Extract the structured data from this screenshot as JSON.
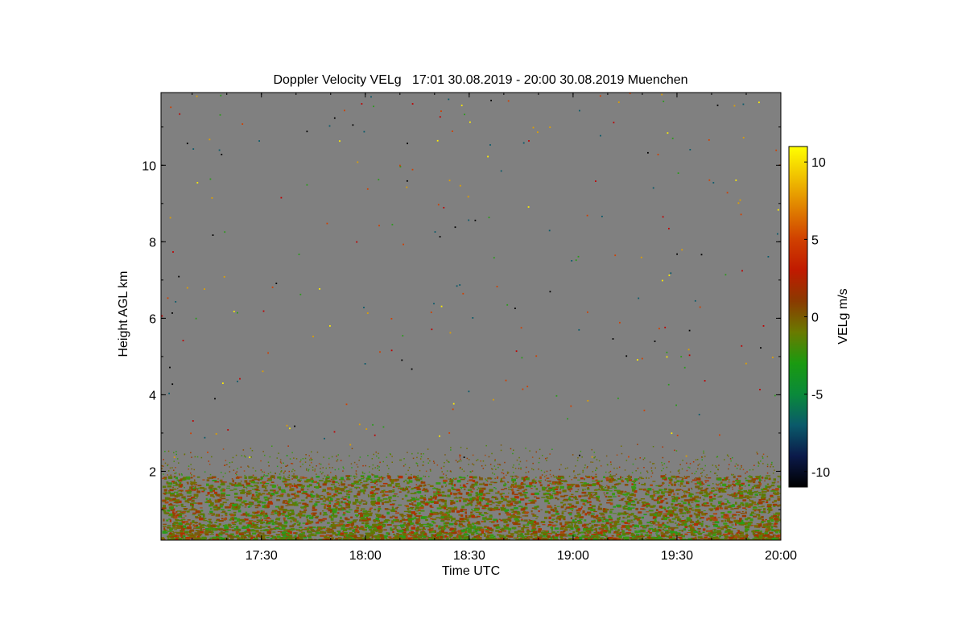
{
  "chart_data": {
    "type": "heatmap",
    "title": "Doppler Velocity VELg   17:01 30.08.2019 - 20:00 30.08.2019 Muenchen",
    "xlabel": "Time UTC",
    "ylabel": "Height AGL km",
    "x_range": [
      "17:01",
      "20:00"
    ],
    "y_range_km": [
      0.2,
      11.9
    ],
    "x_ticks": [
      "17:30",
      "18:00",
      "18:30",
      "19:00",
      "19:30",
      "20:00"
    ],
    "y_ticks": [
      "2",
      "4",
      "6",
      "8",
      "10"
    ],
    "colorbar": {
      "label": "VELg m/s",
      "range": [
        -11,
        11
      ],
      "ticks": [
        "10",
        "5",
        "0",
        "-5",
        "-10"
      ],
      "colors": [
        "#000000",
        "#0b1a4a",
        "#0a5a6a",
        "#0a8a3a",
        "#1a9a10",
        "#6a7a00",
        "#8a3a00",
        "#c01a00",
        "#d04000",
        "#e08000",
        "#f0c000",
        "#ffff00"
      ]
    },
    "background_color": "#808080",
    "echo_top_km": 2.1,
    "series": [
      {
        "layer": "boundary-layer echo",
        "height_km": [
          0.2,
          2.1
        ],
        "dominant_velocity_m_s": [
          -2,
          2
        ]
      }
    ]
  }
}
